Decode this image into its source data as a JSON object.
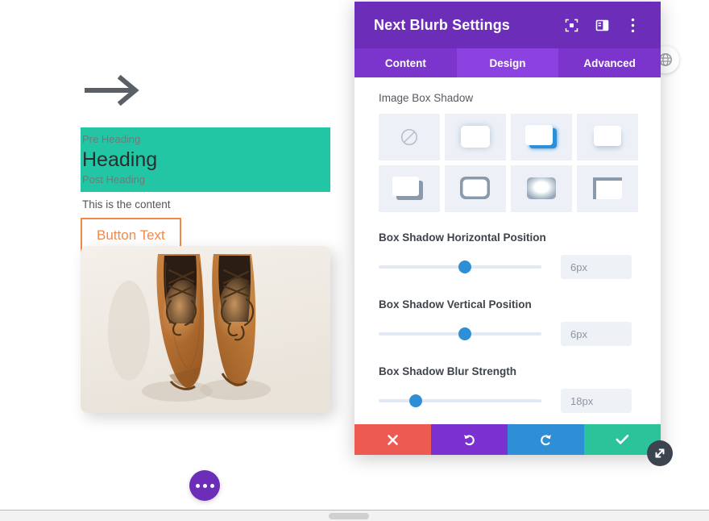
{
  "panel": {
    "title": "Next Blurb Settings",
    "header_icons": [
      {
        "name": "focus-target-icon"
      },
      {
        "name": "layout-panel-icon"
      },
      {
        "name": "more-vertical-icon"
      }
    ],
    "tabs": [
      {
        "label": "Content",
        "active": false
      },
      {
        "label": "Design",
        "active": true
      },
      {
        "label": "Advanced",
        "active": false
      }
    ],
    "section": {
      "label": "Image Box Shadow",
      "presets": [
        {
          "name": "no-shadow",
          "selected": false
        },
        {
          "name": "soft-glow-shadow",
          "selected": false
        },
        {
          "name": "blue-offset-shadow",
          "selected": true
        },
        {
          "name": "bottom-soft-shadow",
          "selected": false
        },
        {
          "name": "offset-bottom-right-shadow",
          "selected": false
        },
        {
          "name": "outline-shadow",
          "selected": false
        },
        {
          "name": "inset-glow-shadow",
          "selected": false
        },
        {
          "name": "top-left-inset-shadow",
          "selected": false
        }
      ]
    },
    "fields": [
      {
        "label": "Box Shadow Horizontal Position",
        "value": "6px",
        "thumb_pct": 53
      },
      {
        "label": "Box Shadow Vertical Position",
        "value": "6px",
        "thumb_pct": 53
      },
      {
        "label": "Box Shadow Blur Strength",
        "value": "18px",
        "thumb_pct": 23
      }
    ],
    "footer": [
      {
        "name": "cancel-button",
        "glyph": "✕"
      },
      {
        "name": "undo-button",
        "glyph": "↺"
      },
      {
        "name": "redo-button",
        "glyph": "↻"
      },
      {
        "name": "save-button",
        "glyph": "✔"
      }
    ]
  },
  "module": {
    "icon": "arrow-right-icon",
    "pre_heading": "Pre Heading",
    "heading": "Heading",
    "post_heading": "Post Heading",
    "content": "This is the content",
    "button_label": "Button Text",
    "image_alt": "brown-leather-shoes-photo"
  },
  "colors": {
    "panel_purple": "#6c2eb9",
    "tab_purple": "#7b35cc",
    "tab_active_purple": "#8b42e0",
    "heading_teal": "#23c6a4",
    "button_orange": "#f08a4b",
    "slider_blue": "#2e8fd6",
    "save_green": "#2bc39a",
    "cancel_red": "#ec5a52"
  }
}
